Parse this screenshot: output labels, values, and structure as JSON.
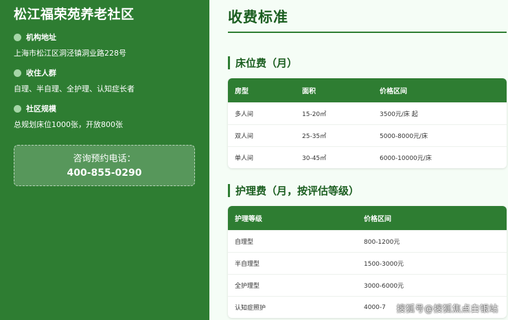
{
  "sidebar": {
    "title": "松江福荣苑养老社区",
    "sections": [
      {
        "heading": "机构地址",
        "text": "上海市松江区洞泾镇洞业路228号"
      },
      {
        "heading": "收住人群",
        "text": "自理、半自理、全护理、认知症长者"
      },
      {
        "heading": "社区规模",
        "text": "总规划床位1000张，开放800张"
      }
    ],
    "contact": {
      "label": "咨询预约电话：",
      "phone": "400-855-0290"
    }
  },
  "main": {
    "title": "收费标准",
    "bed": {
      "heading": "床位费（月）",
      "columns": [
        "房型",
        "面积",
        "价格区间"
      ],
      "rows": [
        [
          "多人间",
          "15-20㎡",
          "3500元/床 起"
        ],
        [
          "双人间",
          "25-35㎡",
          "5000-8000元/床"
        ],
        [
          "单人间",
          "30-45㎡",
          "6000-10000元/床"
        ]
      ]
    },
    "care": {
      "heading": "护理费（月，按评估等级）",
      "columns": [
        "护理等级",
        "价格区间"
      ],
      "rows": [
        [
          "自理型",
          "800-1200元"
        ],
        [
          "半自理型",
          "1500-3000元"
        ],
        [
          "全护理型",
          "3000-6000元"
        ],
        [
          "认知症照护",
          "4000-7"
        ]
      ]
    }
  },
  "watermark": "搜狐号@搜狐焦点白银站"
}
